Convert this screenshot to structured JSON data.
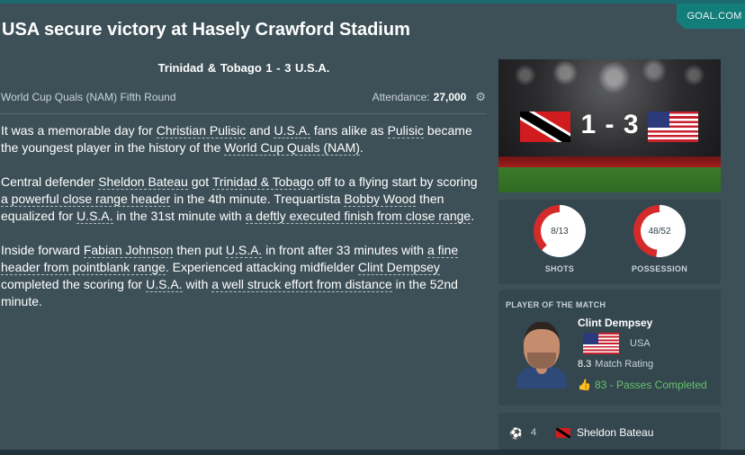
{
  "source_tab": "GOAL.COM",
  "headline": "USA secure victory at Hasely Crawford Stadium",
  "match": {
    "score_line": "Trinidad & Tobago 1 - 3  U.S.A.",
    "competition": "World Cup Quals (NAM) Fifth Round",
    "attendance_label": "Attendance:",
    "attendance_value": "27,000",
    "banner_score": "1 - 3"
  },
  "article": {
    "p1": [
      {
        "t": "It was a memorable day for "
      },
      {
        "t": "Christian Pulisic",
        "l": true
      },
      {
        "t": " and "
      },
      {
        "t": "U.S.A.",
        "l": true
      },
      {
        "t": " fans alike as "
      },
      {
        "t": "Pulisic",
        "l": true
      },
      {
        "t": " became the youngest player in the history of the "
      },
      {
        "t": "World Cup Quals (NAM)",
        "l": true
      },
      {
        "t": "."
      }
    ],
    "p2": [
      {
        "t": "Central defender "
      },
      {
        "t": "Sheldon Bateau",
        "l": true
      },
      {
        "t": " got "
      },
      {
        "t": "Trinidad & Tobago",
        "l": true
      },
      {
        "t": " off to a flying start by scoring "
      },
      {
        "t": "a powerful close range header",
        "l": true
      },
      {
        "t": " in the 4th minute. Trequartista "
      },
      {
        "t": "Bobby Wood",
        "l": true
      },
      {
        "t": " then equalized for "
      },
      {
        "t": "U.S.A.",
        "l": true
      },
      {
        "t": " in the 31st minute with "
      },
      {
        "t": "a deftly executed finish from close range",
        "l": true
      },
      {
        "t": "."
      }
    ],
    "p3": [
      {
        "t": "Inside forward "
      },
      {
        "t": "Fabian Johnson",
        "l": true
      },
      {
        "t": " then put "
      },
      {
        "t": "U.S.A.",
        "l": true
      },
      {
        "t": " in front after 33 minutes with "
      },
      {
        "t": "a fine header from pointblank range",
        "l": true
      },
      {
        "t": ". Experienced attacking midfielder "
      },
      {
        "t": "Clint Dempsey",
        "l": true
      },
      {
        "t": " completed the scoring for "
      },
      {
        "t": "U.S.A.",
        "l": true
      },
      {
        "t": " with "
      },
      {
        "t": "a well struck effort from distance",
        "l": true
      },
      {
        "t": " in the 52nd minute."
      }
    ]
  },
  "stats": {
    "shots": {
      "value": "8/13",
      "label": "SHOTS",
      "home": 8,
      "away": 13
    },
    "possession": {
      "value": "48/52",
      "label": "POSSESSION",
      "home": 48,
      "away": 52
    },
    "ring_home_color": "#d42a2a",
    "ring_away_color": "#ffffff"
  },
  "potm": {
    "title": "PLAYER OF THE MATCH",
    "name": "Clint Dempsey",
    "nation": "USA",
    "rating": "8.3",
    "rating_label": "Match Rating",
    "passes": "83 - Passes Completed"
  },
  "scorer": {
    "minute": "4",
    "name": "Sheldon Bateau"
  },
  "icons": {
    "attendance": "gear-icon",
    "passes": "thumbs-up-icon",
    "goal": "ball-icon"
  },
  "colors": {
    "background": "#3d5058",
    "card": "#34474f",
    "accent_green": "#67c26b",
    "tab_teal": "#137d7a"
  }
}
